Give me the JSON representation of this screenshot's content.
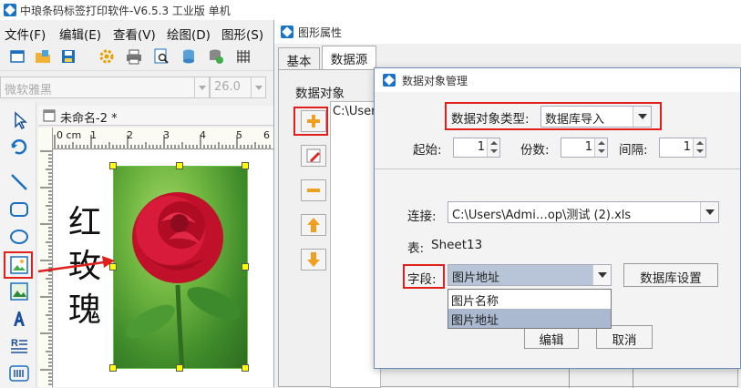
{
  "main_window": {
    "title": "中琅条码标签打印软件-V6.5.3 工业版 单机",
    "menu": [
      "文件(F)",
      "编辑(E)",
      "查看(V)",
      "绘图(D)",
      "图形(S)"
    ],
    "font_name": "微软雅黑",
    "font_size": "26.0",
    "document_tab": "未命名-2 *",
    "ruler_unit": "0 cm",
    "ruler_ticks": [
      "1",
      "2",
      "3",
      "4",
      "5",
      "6"
    ],
    "canvas_text": [
      "红",
      "玫",
      "瑰"
    ]
  },
  "props_window": {
    "title": "图形属性",
    "tabs": [
      "基本",
      "数据源"
    ],
    "active_tab": "数据源",
    "group_label": "数据对象",
    "list_item": "C:\\Users"
  },
  "dialog": {
    "title": "数据对象管理",
    "type_label": "数据对象类型:",
    "type_value": "数据库导入",
    "start_label": "起始:",
    "start_value": "1",
    "copies_label": "份数:",
    "copies_value": "1",
    "interval_label": "间隔:",
    "interval_value": "1",
    "connection_label": "连接:",
    "connection_value": "C:\\Users\\Admi…op\\测试 (2).xls",
    "table_label": "表:",
    "table_value": "Sheet13",
    "field_label": "字段:",
    "field_value": "图片地址",
    "field_options": [
      "图片名称",
      "图片地址"
    ],
    "db_settings_button": "数据库设置",
    "edit_button": "编辑",
    "cancel_button": "取消"
  },
  "colors": {
    "highlight_red": "#e0201c",
    "selected_option": "#aab8d0",
    "field_selected_bg": "#b8c4d8"
  }
}
